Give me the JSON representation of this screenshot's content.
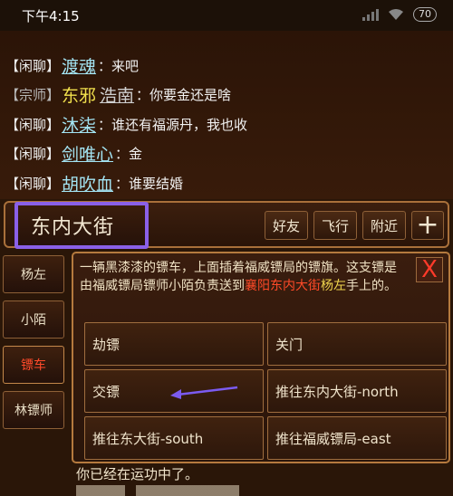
{
  "status": {
    "time": "下午4:15",
    "battery": "70",
    "icons": [
      "signal-icon",
      "wifi-icon",
      "battery-icon"
    ]
  },
  "chat": [
    {
      "channel": "【闲聊】",
      "player": "渡魂",
      "message": "：来吧"
    },
    {
      "channel": "【宗师】",
      "title": "东邪",
      "player": "浩南",
      "message": "：你要金还是啥"
    },
    {
      "channel": "【闲聊】",
      "player": "沐柒",
      "message": "：谁还有福源丹，我也收"
    },
    {
      "channel": "【闲聊】",
      "player": "剑唯心",
      "message": "：金"
    },
    {
      "channel": "【闲聊】",
      "player": "胡吹血",
      "message": "：谁要结婚"
    }
  ],
  "location": {
    "name": "东内大街",
    "buttons": [
      "好友",
      "飞行",
      "附近"
    ],
    "plus": "+"
  },
  "side_tabs": [
    {
      "label": "杨左",
      "active": false
    },
    {
      "label": "小陌",
      "active": false
    },
    {
      "label": "镖车",
      "active": true
    },
    {
      "label": "林镖师",
      "active": false
    }
  ],
  "popup": {
    "desc_part1": "一辆黑漆漆的镖车，上面插着福威镖局的镖旗。这支镖是由福威镖局镖师小陌负责送到",
    "desc_highlight": "襄阳东内大街",
    "desc_name": "杨左",
    "desc_part2": "手上的。",
    "close": "X",
    "actions": [
      "劫镖",
      "关门",
      "交镖",
      "推往东内大街-north",
      "推往东大街-south",
      "推往福威镖局-east"
    ]
  },
  "footer_text": "你已经在运功中了。",
  "colors": {
    "highlight_border": "#8a60e8",
    "accent_red": "#ff4a28",
    "name_yellow": "#f0d64e"
  }
}
